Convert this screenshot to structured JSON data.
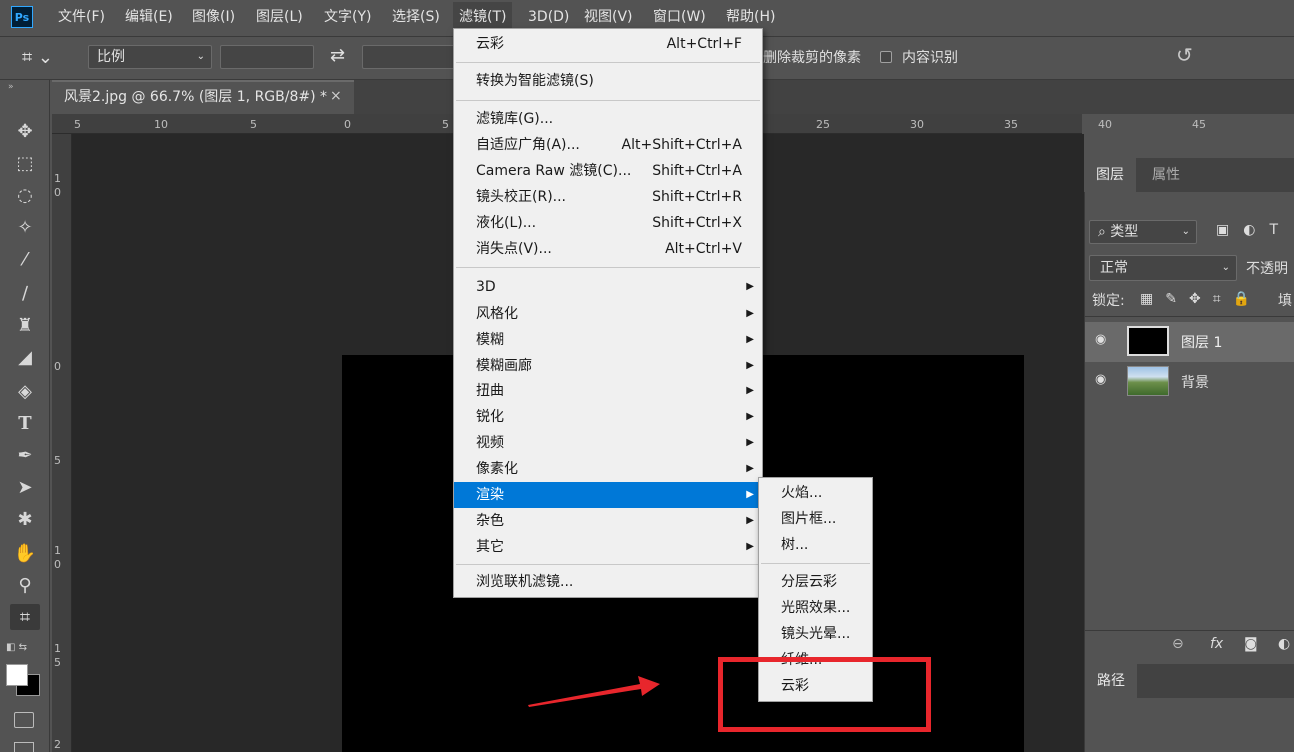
{
  "app": {
    "logo": "Ps"
  },
  "menubar": {
    "items": [
      "文件(F)",
      "编辑(E)",
      "图像(I)",
      "图层(L)",
      "文字(Y)",
      "选择(S)",
      "滤镜(T)",
      "3D(D)",
      "视图(V)",
      "窗口(W)",
      "帮助(H)"
    ],
    "active": "滤镜(T)"
  },
  "options": {
    "ratio": "比例",
    "delete_cropped": "删除裁剪的像素",
    "content_aware": "内容识别"
  },
  "document": {
    "tab_title": "风景2.jpg @ 66.7% (图层 1, RGB/8#) *",
    "close": "×"
  },
  "ruler": {
    "top": [
      "5",
      "10",
      "5",
      "0",
      "5",
      "25",
      "30",
      "35",
      "40",
      "45"
    ],
    "left": [
      "1",
      "0",
      "0",
      "5",
      "1",
      "0",
      "1",
      "5",
      "2"
    ]
  },
  "filter_menu": {
    "last_filter": {
      "label": "云彩",
      "shortcut": "Alt+Ctrl+F"
    },
    "smart": "转换为智能滤镜(S)",
    "group2": [
      {
        "label": "滤镜库(G)...",
        "shortcut": ""
      },
      {
        "label": "自适应广角(A)...",
        "shortcut": "Alt+Shift+Ctrl+A"
      },
      {
        "label": "Camera Raw 滤镜(C)...",
        "shortcut": "Shift+Ctrl+A"
      },
      {
        "label": "镜头校正(R)...",
        "shortcut": "Shift+Ctrl+R"
      },
      {
        "label": "液化(L)...",
        "shortcut": "Shift+Ctrl+X"
      },
      {
        "label": "消失点(V)...",
        "shortcut": "Alt+Ctrl+V"
      }
    ],
    "submenus": [
      "3D",
      "风格化",
      "模糊",
      "模糊画廊",
      "扭曲",
      "锐化",
      "视频",
      "像素化",
      "渲染",
      "杂色",
      "其它"
    ],
    "highlighted": "渲染",
    "browse": "浏览联机滤镜..."
  },
  "render_submenu": {
    "group1": [
      "火焰...",
      "图片框...",
      "树..."
    ],
    "group2": [
      "分层云彩",
      "光照效果...",
      "镜头光晕...",
      "纤维...",
      "云彩"
    ]
  },
  "layers_panel": {
    "tabs": [
      "图层",
      "属性"
    ],
    "filter_kind": "类型",
    "blend_mode": "正常",
    "opacity_label": "不透明",
    "lock_label": "锁定:",
    "fill_label": "填",
    "layers": [
      {
        "name": "图层 1",
        "selected": true
      },
      {
        "name": "背景",
        "selected": false
      }
    ],
    "fx": "fx",
    "paths_tab": "路径"
  },
  "colors": {
    "highlight": "#0078d7",
    "annotation": "#e8262c"
  }
}
